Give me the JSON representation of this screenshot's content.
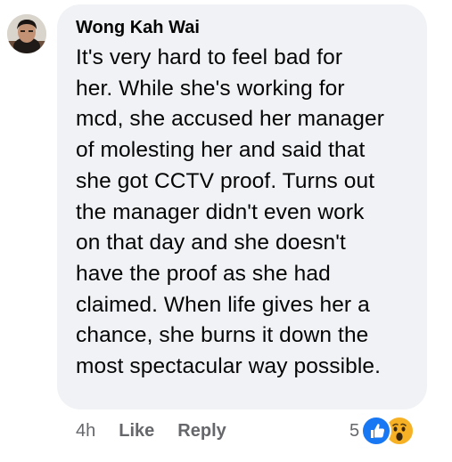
{
  "comment": {
    "author": "Wong Kah Wai",
    "text_lines": [
      "It's very hard to feel bad for",
      "her. While she's working for",
      "mcd, she accused her manager",
      "of molesting her and said that",
      "she got CCTV proof. Turns out",
      "the manager didn't even work",
      "on that day and she doesn't",
      "have the proof as she had",
      "claimed. When life gives her a",
      "chance, she burns it down the",
      "most spectacular way possible."
    ],
    "timestamp": "4h",
    "like_label": "Like",
    "reply_label": "Reply",
    "reaction_count": "5",
    "reaction_icons": [
      "like-reaction-icon",
      "wow-reaction-icon"
    ]
  },
  "colors": {
    "bubble_bg": "#f0f2f5",
    "text": "#050505",
    "meta_text": "#65676b",
    "like_blue": "#1877f2",
    "wow_yellow": "#f7b125"
  }
}
